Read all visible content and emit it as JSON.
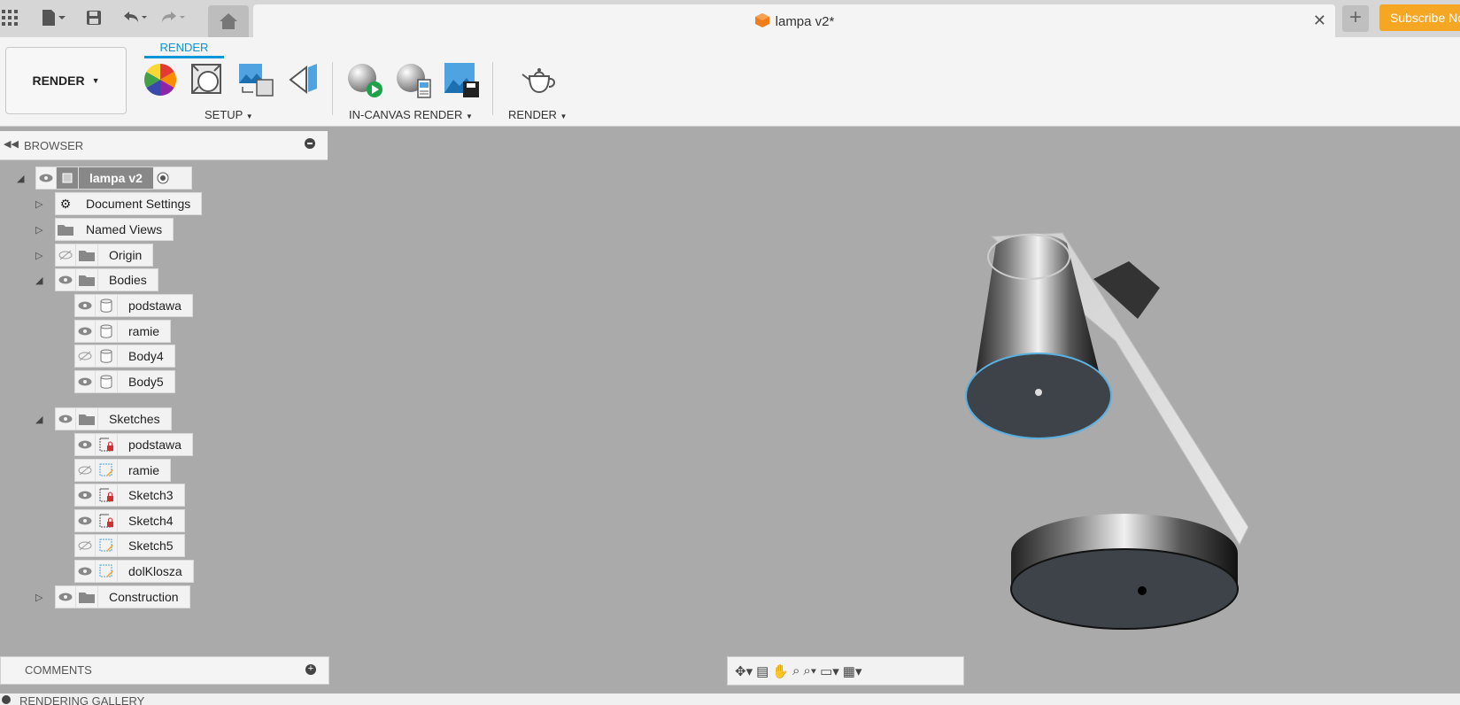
{
  "topbar": {
    "doc_title": "lampa v2*",
    "subscribe_label": "Subscribe Now"
  },
  "ribbon": {
    "workspace_label": "RENDER",
    "tab_label": "RENDER",
    "groups": {
      "setup": "SETUP",
      "in_canvas": "IN-CANVAS RENDER",
      "render": "RENDER"
    }
  },
  "browser": {
    "title": "BROWSER",
    "root": "lampa v2",
    "items": [
      {
        "label": "Document Settings"
      },
      {
        "label": "Named Views"
      },
      {
        "label": "Origin"
      },
      {
        "label": "Bodies"
      },
      {
        "label": "podstawa"
      },
      {
        "label": "ramie"
      },
      {
        "label": "Body4"
      },
      {
        "label": "Body5"
      },
      {
        "label": "Sketches"
      },
      {
        "label": "podstawa"
      },
      {
        "label": "ramie"
      },
      {
        "label": "Sketch3"
      },
      {
        "label": "Sketch4"
      },
      {
        "label": "Sketch5"
      },
      {
        "label": "dolKlosza"
      },
      {
        "label": "Construction"
      }
    ]
  },
  "comments": {
    "title": "COMMENTS"
  },
  "gallery": {
    "title": "RENDERING GALLERY"
  },
  "colors": {
    "accent": "#0696d7",
    "subscribe": "#f5a623",
    "canvas": "#aaaaaa"
  }
}
